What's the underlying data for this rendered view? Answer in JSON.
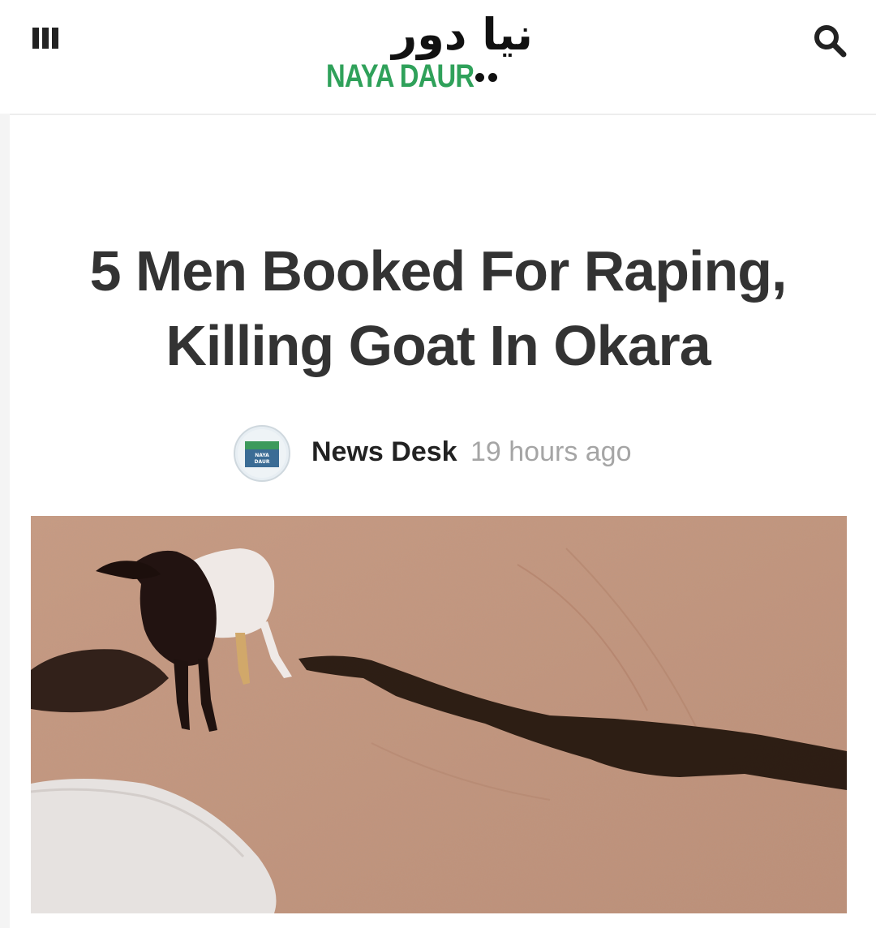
{
  "header": {
    "logo_urdu": "نیا دور",
    "logo_text": "NAYA DAUR",
    "menu_icon": "hamburger-menu-icon",
    "search_icon": "search-icon"
  },
  "article": {
    "title_line1": "5 Men Booked For Raping,",
    "title_line2": "Killing Goat In Okara",
    "author": "News Desk",
    "time": "19 hours ago",
    "avatar_text": "NAYA DAUR"
  },
  "colors": {
    "brand_green": "#2fa15a",
    "title": "#333333",
    "meta_gray": "#a5a5a5"
  }
}
